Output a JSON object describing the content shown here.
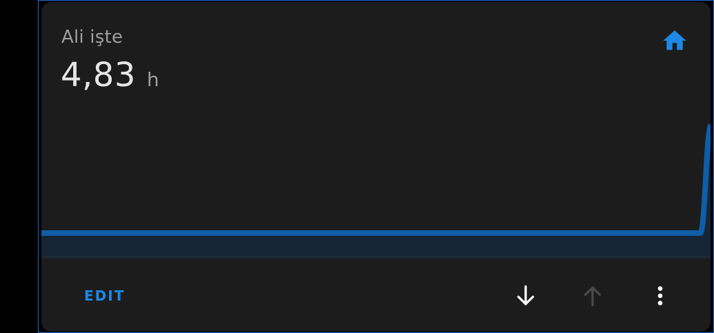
{
  "card": {
    "title": "Ali işte",
    "value": "4,83",
    "unit": "h",
    "icon": "home-icon",
    "accent_color": "#1e88e5"
  },
  "actions": {
    "edit_label": "EDIT",
    "move_down_icon": "arrow-down-icon",
    "move_up_icon": "arrow-up-icon",
    "menu_icon": "more-vertical-icon"
  }
}
